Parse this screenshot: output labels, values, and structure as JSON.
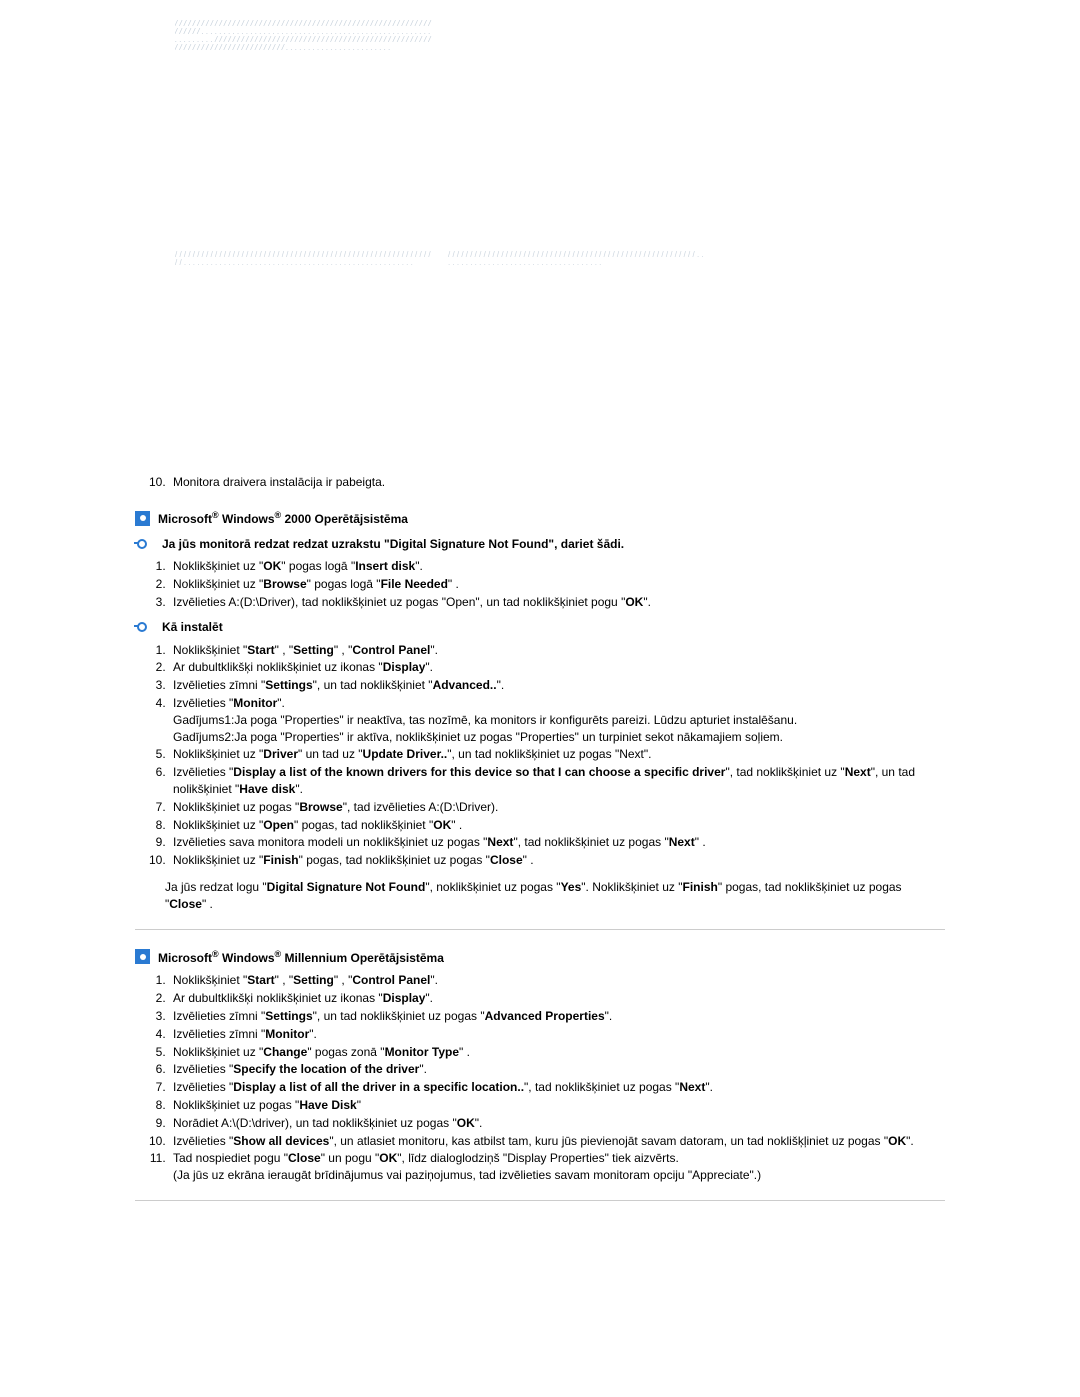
{
  "step10": "Monitora draivera instalācija ir pabeigta.",
  "sec_win2000": {
    "prefix": "Microsoft",
    "mid": " Windows",
    "suffix": " 2000 Operētājsistēma"
  },
  "sig_heading": "Ja jūs monitorā redzat redzat uzrakstu \"Digital Signature Not Found\", dariet šādi.",
  "sig_list": [
    {
      "pre": "Noklikšķiniet uz \"",
      "b1": "OK",
      "mid": "\" pogas logā \"",
      "b2": "Insert disk",
      "post": "\"."
    },
    {
      "pre": "Noklikšķiniet uz \"",
      "b1": "Browse",
      "mid": "\" pogas logā \"",
      "b2": "File Needed",
      "post": "\" ."
    },
    {
      "text": "Izvēlieties A:(D:\\Driver), tad noklikšķiniet uz pogas \"Open\", un tad noklikšķiniet pogu \"",
      "b": "OK",
      "post": "\"."
    }
  ],
  "install_heading": "Kā instalēt",
  "install_list": [
    {
      "pre": "Noklikšķiniet \"",
      "b": [
        "Start",
        "Setting",
        "Control Panel"
      ],
      "sep": "\" , \"",
      "post": "\"."
    },
    {
      "pre": "Ar dubultklikšķi noklikšķiniet uz ikonas \"",
      "b": [
        "Display"
      ],
      "post": "\"."
    },
    {
      "pre": "Izvēlieties zīmni \"",
      "b": [
        "Settings"
      ],
      "mid": "\", un tad noklikšķiniet \"",
      "b2": "Advanced..",
      "post": "\"."
    },
    {
      "pre": "Izvēlieties \"",
      "b": [
        "Monitor"
      ],
      "post": "\".",
      "sub": [
        "Gadījums1:Ja poga \"Properties\" ir neaktīva, tas nozīmē, ka monitors ir konfigurēts pareizi. Lūdzu apturiet instalēšanu.",
        "Gadījums2:Ja poga \"Properties\" ir aktīva, noklikšķiniet uz pogas \"Properties\" un turpiniet sekot nākamajiem soļiem."
      ]
    },
    {
      "raw": "Noklikšķiniet uz \"<b>Driver</b>\" un tad uz \"<b>Update Driver..</b>\", un tad noklikšķiniet uz pogas \"Next\"."
    },
    {
      "raw": "Izvēlieties \"<b>Display a list of the known drivers for this device so that I can choose a specific driver</b>\", tad noklikšķiniet uz \"<b>Next</b>\", un tad nolikšķiniet \"<b>Have disk</b>\"."
    },
    {
      "raw": "Noklikšķiniet uz pogas \"<b>Browse</b>\", tad izvēlieties A:(D:\\Driver)."
    },
    {
      "raw": "Noklikšķiniet uz \"<b>Open</b>\" pogas, tad noklikšķiniet \"<b>OK</b>\" ."
    },
    {
      "raw": "Izvēlieties sava monitora modeli un noklikšķiniet uz pogas \"<b>Next</b>\", tad noklikšķiniet uz pogas \"<b>Next</b>\" ."
    },
    {
      "raw": "Noklikšķiniet uz \"<b>Finish</b>\" pogas, tad noklikšķiniet uz pogas \"<b>Close</b>\" ."
    }
  ],
  "install_para": "Ja jūs redzat logu \"<b>Digital Signature Not Found</b>\", noklikšķiniet uz pogas \"<b>Yes</b>\". Noklikšķiniet uz \"<b>Finish</b>\" pogas, tad noklikšķiniet uz pogas \"<b>Close</b>\" .",
  "sec_winme": {
    "prefix": "Microsoft",
    "mid": " Windows",
    "suffix": " Millennium Operētājsistēma"
  },
  "me_list": [
    "Noklikšķiniet \"<b>Start</b>\" , \"<b>Setting</b>\" , \"<b>Control Panel</b>\".",
    "Ar dubultklikšķi noklikšķiniet uz ikonas \"<b>Display</b>\".",
    "Izvēlieties zīmni \"<b>Settings</b>\", un tad noklikšķiniet uz pogas \"<b>Advanced Properties</b>\".",
    "Izvēlieties zīmni \"<b>Monitor</b>\".",
    "Noklikšķiniet uz \"<b>Change</b>\" pogas zonā \"<b>Monitor Type</b>\" .",
    "Izvēlieties \"<b>Specify the location of the driver</b>\".",
    "Izvēlieties \"<b>Display a list of all the driver in a specific location..</b>\", tad noklikšķiniet uz pogas \"<b>Next</b>\".",
    "Noklikšķiniet uz pogas \"<b>Have Disk</b>\"",
    "Norādiet A:\\(D:\\driver), un tad noklikšķiniet uz pogas \"<b>OK</b>\".",
    "Izvēlieties \"<b>Show all devices</b>\", un atlasiet monitoru, kas atbilst tam, kuru jūs pievienojāt savam datoram, un tad noklišķļiniet uz pogas \"<b>OK</b>\".",
    "Tad nospiediet pogu \"<b>Close</b>\" un pogu \"<b>OK</b>\", līdz dialoglodziņš \"Display Properties\" tiek aizvērts.<br>(Ja jūs uz ekrāna ieraugāt brīdinājumus vai paziņojumus, tad izvēlieties savam monitoram opciju \"Appreciate\".)"
  ]
}
